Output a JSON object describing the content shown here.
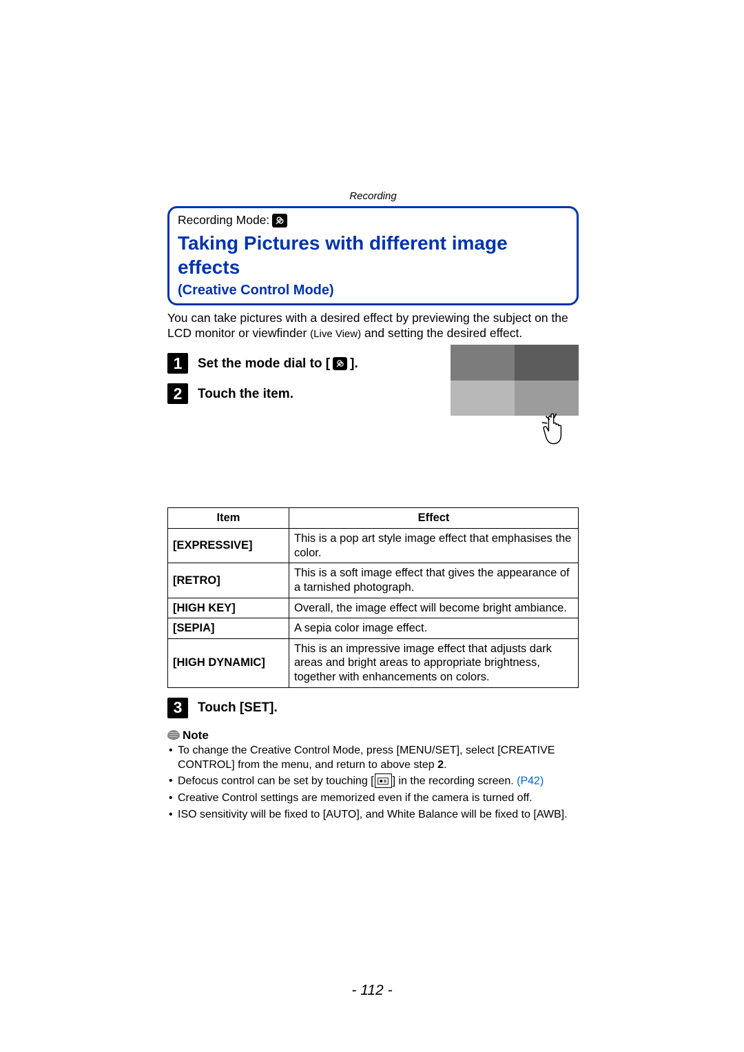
{
  "section_header": "Recording",
  "recording_mode_label": "Recording Mode:",
  "title": "Taking Pictures with different image effects",
  "subtitle": "(Creative Control Mode)",
  "intro_before": "You can take pictures with a desired effect by previewing the subject on the LCD monitor or viewfinder ",
  "live_view": "(Live View)",
  "intro_after": " and setting the desired effect.",
  "steps": [
    {
      "num": "1",
      "text_before": "Set the mode dial to [",
      "text_after": "]."
    },
    {
      "num": "2",
      "text": "Touch the item."
    },
    {
      "num": "3",
      "text": "Touch [SET]."
    }
  ],
  "table": {
    "headers": [
      "Item",
      "Effect"
    ],
    "rows": [
      {
        "item": "[EXPRESSIVE]",
        "effect": "This is a pop art style image effect that emphasises the color."
      },
      {
        "item": "[RETRO]",
        "effect": "This is a soft image effect that gives the appearance of a tarnished photograph."
      },
      {
        "item": "[HIGH KEY]",
        "effect": "Overall, the image effect will become bright ambiance."
      },
      {
        "item": "[SEPIA]",
        "effect": "A sepia color image effect."
      },
      {
        "item": "[HIGH DYNAMIC]",
        "effect": "This is an impressive image effect that adjusts dark areas and bright areas to appropriate brightness, together with enhancements on colors."
      }
    ]
  },
  "note_label": "Note",
  "notes": {
    "n1a": "To change the Creative Control Mode, press [MENU/SET], select [CREATIVE CONTROL] from the menu, and return to above step ",
    "n1b": "2",
    "n1c": ".",
    "n2a": "Defocus control can be set by touching [",
    "n2b": "] in the recording screen. ",
    "n2link": "(P42)",
    "n3": "Creative Control settings are memorized even if the camera is turned off.",
    "n4": "ISO sensitivity will be fixed to [AUTO], and White Balance will be fixed to [AWB]."
  },
  "page_number": "- 112 -"
}
